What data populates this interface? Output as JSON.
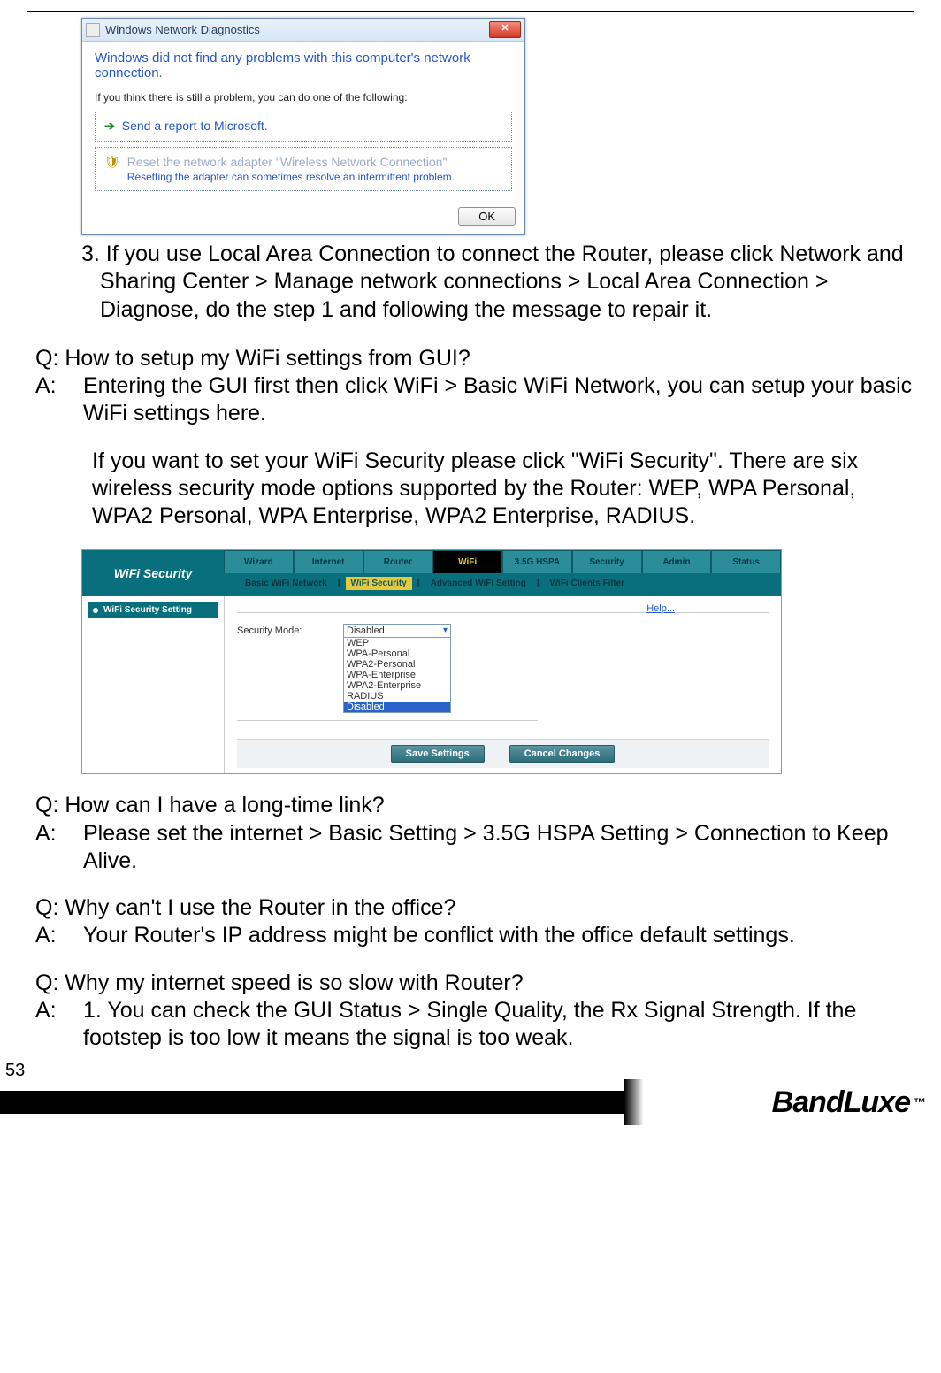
{
  "page_number": "53",
  "brand": "BandLuxe",
  "trademark": "™",
  "windows_dialog": {
    "title": "Windows Network Diagnostics",
    "close": "✕",
    "message": "Windows did not find any problems with this computer's network connection.",
    "sub": "If you think there is still a problem, you can do one of the following:",
    "option1": "Send a report to Microsoft.",
    "option2_title": "Reset the network adapter \"Wireless Network Connection\"",
    "option2_sub": "Resetting the adapter can sometimes resolve an intermittent problem.",
    "ok": "OK"
  },
  "step3": {
    "prefix": "3. ",
    "text": "If you use Local Area Connection to connect the Router, please click Network and Sharing Center > Manage network connections > Local Area Connection > Diagnose, do the step 1 and following the message to repair it."
  },
  "qa1": {
    "q": "Q: How to setup my WiFi settings from GUI?",
    "a_label": "A:",
    "a1": "Entering the GUI first then click WiFi > Basic WiFi Network, you can setup your basic WiFi settings here.",
    "a2": "If you want to set your WiFi Security please click \"WiFi Security\". There are six wireless security mode options supported by the Router: WEP, WPA Personal, WPA2 Personal, WPA Enterprise, WPA2 Enterprise, RADIUS."
  },
  "router_gui": {
    "section_title": "WiFi Security",
    "tabs": [
      "Wizard",
      "Internet",
      "Router",
      "WiFi",
      "3.5G HSPA",
      "Security",
      "Admin",
      "Status"
    ],
    "active_tab_index": 3,
    "subtabs": [
      "Basic WiFi Network",
      "WiFi Security",
      "Advanced WiFi Setting",
      "WiFi Clients Filter"
    ],
    "active_subtab_index": 1,
    "sidebar_item": "WiFi Security Setting",
    "help": "Help...",
    "field_label": "Security Mode:",
    "selected_option": "Disabled",
    "options": [
      "WEP",
      "WPA-Personal",
      "WPA2-Personal",
      "WPA-Enterprise",
      "WPA2-Enterprise",
      "RADIUS",
      "Disabled"
    ],
    "save_btn": "Save Settings",
    "cancel_btn": "Cancel Changes"
  },
  "qa2": {
    "q": "Q: How can I have a long-time link?",
    "a_label": "A:",
    "a": "Please set the internet > Basic Setting > 3.5G HSPA Setting > Connection to Keep Alive."
  },
  "qa3": {
    "q": "Q: Why can't I use the Router in the office?",
    "a_label": "A:",
    "a": "Your Router's IP address might be conflict with the office default settings."
  },
  "qa4": {
    "q": "Q: Why my internet speed is so slow with Router?",
    "a_label": "A:",
    "a": "1. You can check the GUI Status > Single Quality, the Rx Signal Strength. If the footstep is too low it means the signal is too weak."
  }
}
